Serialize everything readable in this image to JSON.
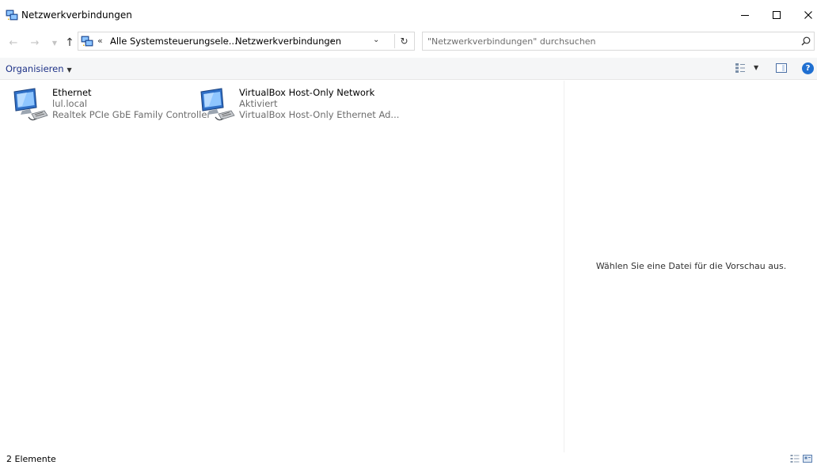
{
  "window": {
    "title": "Netzwerkverbindungen",
    "minimize_label": "–",
    "maximize_label": "☐",
    "close_label": "✕"
  },
  "nav": {
    "back_label": "←",
    "forward_label": "→",
    "recent_label": "▼",
    "up_label": "↑",
    "overflow_label": "«",
    "breadcrumbs": [
      {
        "label": "Alle Systemsteuerungsele..."
      },
      {
        "label": "Netzwerkverbindungen"
      }
    ],
    "breadcrumb_separator": "›",
    "dropdown_label": "⌄",
    "refresh_label": "↻"
  },
  "search": {
    "placeholder": "\"Netzwerkverbindungen\" durchsuchen"
  },
  "commandbar": {
    "organize_label": "Organisieren",
    "organize_caret": "▼",
    "view_caret": "▼",
    "help_label": "?"
  },
  "connections": [
    {
      "name": "Ethernet",
      "status": "lul.local",
      "device": "Realtek PCIe GbE Family Controller"
    },
    {
      "name": "VirtualBox Host-Only Network",
      "status": "Aktiviert",
      "device": "VirtualBox Host-Only Ethernet Ad..."
    }
  ],
  "preview": {
    "message": "Wählen Sie eine Datei für die Vorschau aus."
  },
  "statusbar": {
    "item_count": "2 Elemente"
  },
  "colors": {
    "accent": "#1e3287",
    "help": "#1f6fd1",
    "secondary_text": "#6d6d6d",
    "border": "#d9d9d9"
  }
}
